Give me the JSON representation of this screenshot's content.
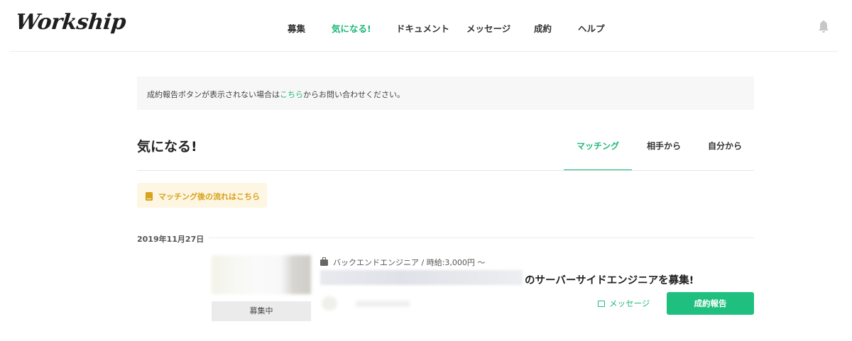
{
  "header": {
    "logo": "Workship",
    "nav": [
      {
        "label": "募集",
        "active": false
      },
      {
        "label": "気になる!",
        "active": true
      },
      {
        "label": "ドキュメント",
        "active": false
      },
      {
        "label": "メッセージ",
        "active": false
      },
      {
        "label": "成約",
        "active": false
      },
      {
        "label": "ヘルプ",
        "active": false
      }
    ],
    "bell_icon": "bell-icon"
  },
  "notice": {
    "before": "成約報告ボタンが表示されない場合は",
    "link": "こちら",
    "after": "からお問い合わせください。"
  },
  "section": {
    "title": "気になる!",
    "tabs": [
      {
        "label": "マッチング",
        "active": true
      },
      {
        "label": "相手から",
        "active": false
      },
      {
        "label": "自分から",
        "active": false
      }
    ]
  },
  "flow_button": {
    "label": "マッチング後の流れはこちら",
    "icon": "book-icon"
  },
  "date": "2019年11月27日",
  "card": {
    "status": "募集中",
    "category": "バックエンドエンジニア / 時給:3,000円 〜",
    "category_icon": "briefcase-icon",
    "title_suffix": "のサーバーサイドエンジニアを募集!",
    "message_label": "メッセージ",
    "message_icon": "chat-icon",
    "report_label": "成約報告"
  },
  "colors": {
    "accent": "#1fb978",
    "button": "#1fbf7f",
    "flow_text": "#d8a21a",
    "flow_bg": "#fdf6e3"
  }
}
